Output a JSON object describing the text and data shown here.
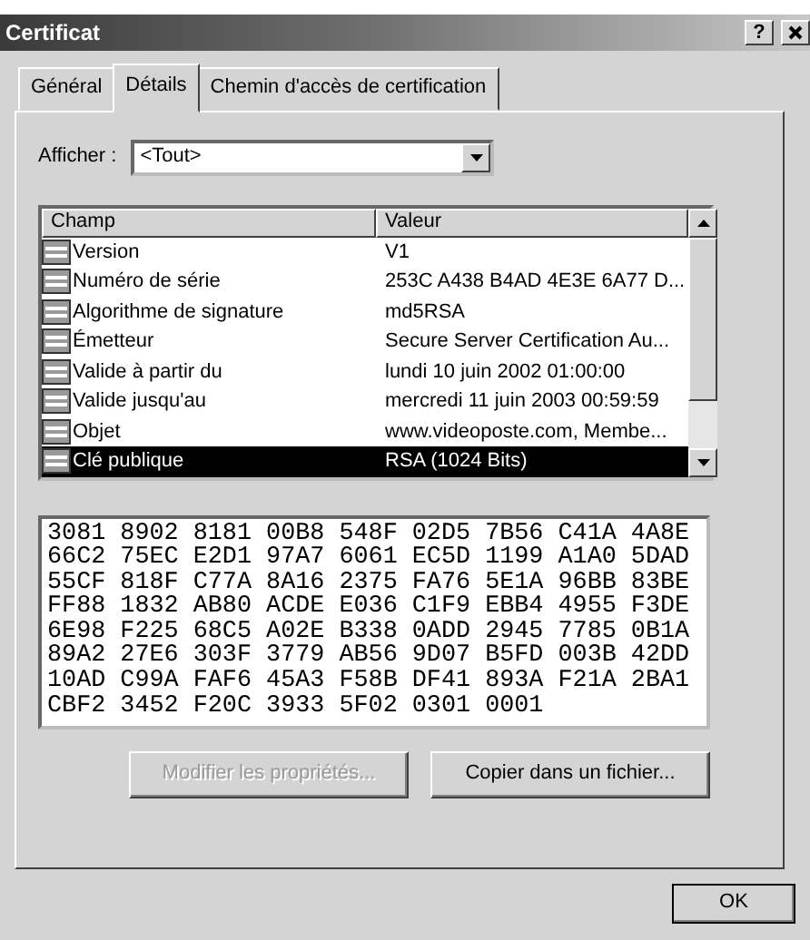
{
  "window": {
    "title": "Certificat",
    "help_button": "?"
  },
  "tabs": [
    {
      "label": "Général",
      "selected": false
    },
    {
      "label": "Détails",
      "selected": true
    },
    {
      "label": "Chemin d'accès de certification",
      "selected": false
    }
  ],
  "show": {
    "label": "Afficher :",
    "value": "<Tout>"
  },
  "fields_table": {
    "columns": [
      "Champ",
      "Valeur"
    ],
    "rows": [
      {
        "field": "Version",
        "value": "V1",
        "selected": false
      },
      {
        "field": "Numéro de série",
        "value": "253C A438 B4AD 4E3E 6A77 D...",
        "selected": false
      },
      {
        "field": "Algorithme de signature",
        "value": "md5RSA",
        "selected": false
      },
      {
        "field": "Émetteur",
        "value": "Secure Server Certification Au...",
        "selected": false
      },
      {
        "field": "Valide à partir du",
        "value": "lundi 10 juin 2002 01:00:00",
        "selected": false
      },
      {
        "field": "Valide jusqu'au",
        "value": "mercredi 11 juin 2003 00:59:59",
        "selected": false
      },
      {
        "field": "Objet",
        "value": "www.videoposte.com, Membe...",
        "selected": false
      },
      {
        "field": "Clé publique",
        "value": "RSA (1024 Bits)",
        "selected": true
      }
    ]
  },
  "detail_lines": [
    "3081 8902 8181 00B8 548F 02D5 7B56 C41A 4A8E",
    "66C2 75EC E2D1 97A7 6061 EC5D 1199 A1A0 5DAD",
    "55CF 818F C77A 8A16 2375 FA76 5E1A 96BB 83BE",
    "FF88 1832 AB80 ACDE E036 C1F9 EBB4 4955 F3DE",
    "6E98 F225 68C5 A02E B338 0ADD 2945 7785 0B1A",
    "89A2 27E6 303F 3779 AB56 9D07 B5FD 003B 42DD",
    "10AD C99A FAF6 45A3 F58B DF41 893A F21A 2BA1",
    "CBF2 3452 F20C 3933 5F02 0301 0001"
  ],
  "actions": [
    {
      "label": "Modifier les propriétés...",
      "disabled": true
    },
    {
      "label": "Copier dans un fichier...",
      "disabled": false
    }
  ],
  "footer_buttons": [
    {
      "label": "OK",
      "disabled": false
    }
  ]
}
